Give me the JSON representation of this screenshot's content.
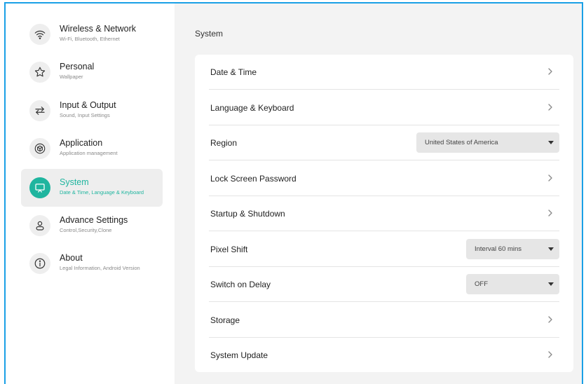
{
  "sidebar": {
    "items": [
      {
        "title": "Wireless & Network",
        "subtitle": "Wi-Fi, Bluetooth, Ethernet",
        "icon": "wifi-icon"
      },
      {
        "title": "Personal",
        "subtitle": "Wallpaper",
        "icon": "star-icon"
      },
      {
        "title": "Input & Output",
        "subtitle": "Sound, Input Settings",
        "icon": "swap-arrows-icon"
      },
      {
        "title": "Application",
        "subtitle": "Application management",
        "icon": "cube-icon"
      },
      {
        "title": "System",
        "subtitle": "Date & Time, Language & Keyboard",
        "icon": "screen-icon",
        "active": true
      },
      {
        "title": "Advance Settings",
        "subtitle": "Control,Security,Clone",
        "icon": "user-icon"
      },
      {
        "title": "About",
        "subtitle": "Legal Information, Android Version",
        "icon": "info-icon"
      }
    ]
  },
  "main": {
    "title": "System",
    "rows": [
      {
        "label": "Date & Time",
        "type": "link"
      },
      {
        "label": "Language & Keyboard",
        "type": "link"
      },
      {
        "label": "Region",
        "type": "select",
        "value": "United States of America"
      },
      {
        "label": "Lock Screen Password",
        "type": "link"
      },
      {
        "label": "Startup & Shutdown",
        "type": "link"
      },
      {
        "label": "Pixel Shift",
        "type": "select",
        "value": "Interval 60 mins"
      },
      {
        "label": "Switch on Delay",
        "type": "select",
        "value": "OFF"
      },
      {
        "label": "Storage",
        "type": "link"
      },
      {
        "label": "System Update",
        "type": "link"
      }
    ]
  },
  "colors": {
    "accent": "#1fb59f",
    "frame": "#1aa0e6",
    "background": "#f3f3f3"
  }
}
